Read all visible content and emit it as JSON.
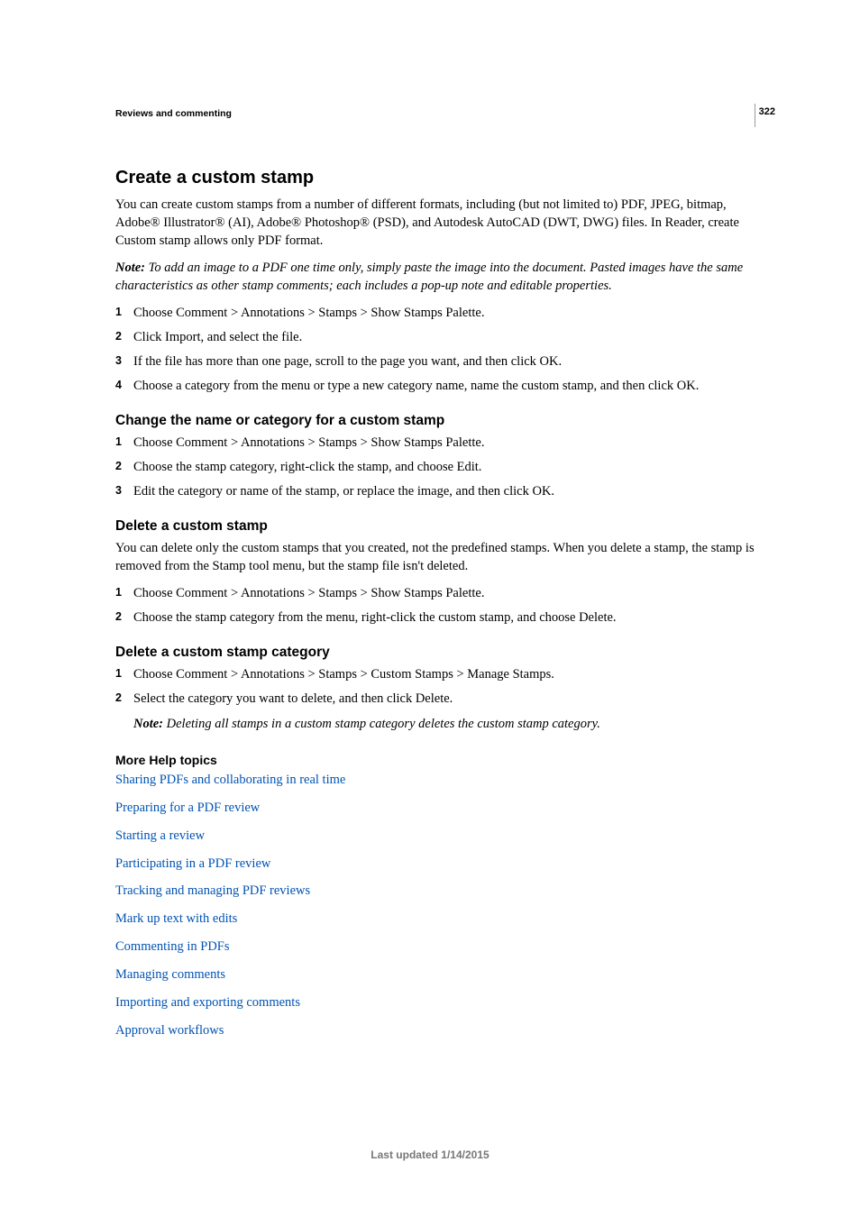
{
  "page_number": "322",
  "breadcrumb": "Reviews and commenting",
  "h1": "Create a custom stamp",
  "intro_p": "You can create custom stamps from a number of different formats, including (but not limited to) PDF, JPEG, bitmap, Adobe® Illustrator® (AI), Adobe® Photoshop® (PSD), and Autodesk AutoCAD (DWT, DWG) files. In Reader, create Custom stamp allows only PDF format.",
  "note_label": "Note: ",
  "intro_note": "To add an image to a PDF one time only, simply paste the image into the document. Pasted images have the same characteristics as other stamp comments; each includes a pop-up note and editable properties.",
  "steps_create": [
    "Choose Comment > Annotations > Stamps > Show Stamps Palette.",
    "Click Import, and select the file.",
    "If the file has more than one page, scroll to the page you want, and then click OK.",
    "Choose a category from the menu or type a new category name, name the custom stamp, and then click OK."
  ],
  "h2_change": "Change the name or category for a custom stamp",
  "steps_change": [
    "Choose Comment > Annotations > Stamps > Show Stamps Palette.",
    "Choose the stamp category, right-click the stamp, and choose Edit.",
    "Edit the category or name of the stamp, or replace the image, and then click OK."
  ],
  "h2_delete_stamp": "Delete a custom stamp",
  "delete_stamp_p": "You can delete only the custom stamps that you created, not the predefined stamps. When you delete a stamp, the stamp is removed from the Stamp tool menu, but the stamp file isn't deleted.",
  "steps_delete_stamp": [
    "Choose Comment > Annotations > Stamps > Show Stamps Palette.",
    "Choose the stamp category from the menu, right-click the custom stamp, and choose Delete."
  ],
  "h2_delete_cat": "Delete a custom stamp category",
  "steps_delete_cat": [
    "Choose Comment > Annotations > Stamps > Custom Stamps > Manage Stamps.",
    "Select the category you want to delete, and then click Delete."
  ],
  "delete_cat_note": "Deleting all stamps in a custom stamp category deletes the custom stamp category.",
  "h3_more": "More Help topics",
  "links": [
    "Sharing PDFs and collaborating in real time",
    "Preparing for a PDF review",
    "Starting a review",
    "Participating in a PDF review",
    "Tracking and managing PDF reviews",
    "Mark up text with edits",
    "Commenting in PDFs",
    "Managing comments",
    "Importing and exporting comments",
    "Approval workflows"
  ],
  "footer": "Last updated 1/14/2015"
}
